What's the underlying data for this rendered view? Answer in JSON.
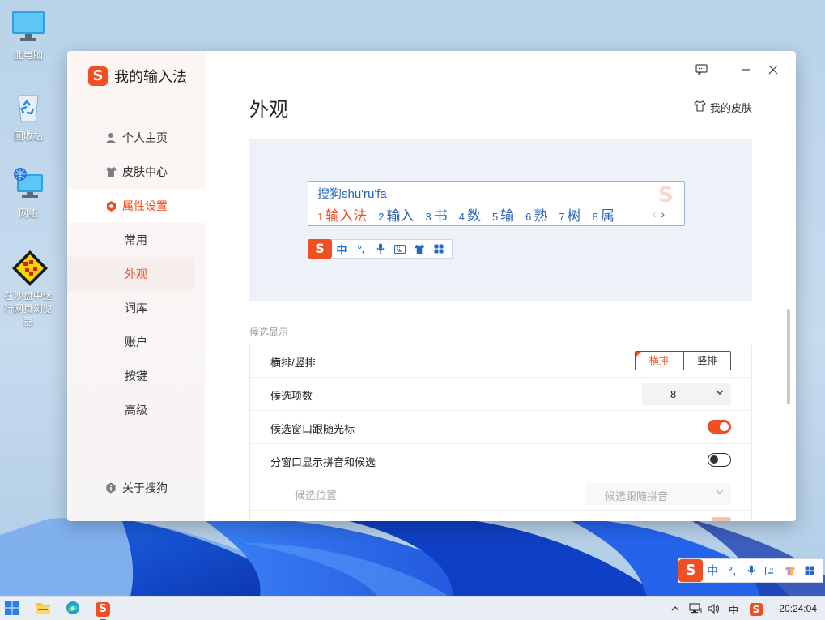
{
  "desktop": {
    "icons": [
      {
        "label": "此电脑"
      },
      {
        "label": "回收站"
      },
      {
        "label": "网络"
      },
      {
        "label": "在沙盘中运行网页浏览器"
      }
    ]
  },
  "window": {
    "app_title": "我的输入法",
    "nav": [
      {
        "label": "个人主页",
        "icon": "user-icon"
      },
      {
        "label": "皮肤中心",
        "icon": "tshirt-icon"
      },
      {
        "label": "属性设置",
        "icon": "settings-hex-icon",
        "active": true
      }
    ],
    "subnav": [
      {
        "label": "常用"
      },
      {
        "label": "外观",
        "active": true
      },
      {
        "label": "词库"
      },
      {
        "label": "账户"
      },
      {
        "label": "按键"
      },
      {
        "label": "高级"
      }
    ],
    "about": "关于搜狗",
    "page_title": "外观",
    "my_skin": "我的皮肤",
    "preview": {
      "pinyin": "搜狗shu'ru'fa",
      "candidates": [
        {
          "num": "1",
          "text": "输入法"
        },
        {
          "num": "2",
          "text": "输入"
        },
        {
          "num": "3",
          "text": "书"
        },
        {
          "num": "4",
          "text": "数"
        },
        {
          "num": "5",
          "text": "输"
        },
        {
          "num": "6",
          "text": "熟"
        },
        {
          "num": "7",
          "text": "树"
        },
        {
          "num": "8",
          "text": "属"
        }
      ],
      "prev_arrow": "‹",
      "next_arrow": "›",
      "logo": "S",
      "status_items": [
        "中",
        "°,",
        "mic",
        "keyboard",
        "skin",
        "toolbox"
      ]
    },
    "section_label": "候选显示",
    "settings": [
      {
        "label": "横排/竖排",
        "type": "segmented",
        "options": [
          "横排",
          "竖排"
        ],
        "selected": "横排"
      },
      {
        "label": "候选项数",
        "type": "select",
        "value": "8"
      },
      {
        "label": "候选窗口跟随光标",
        "type": "toggle",
        "on": true
      },
      {
        "label": "分窗口显示拼音和候选",
        "type": "toggle",
        "on": false
      },
      {
        "label": "候选位置",
        "type": "select",
        "value": "候选跟随拼音",
        "disabled": true
      }
    ]
  },
  "ime_float": {
    "logo": "S",
    "zh": "中",
    "punct": "°,"
  },
  "taskbar": {
    "ime_label": "中",
    "clock": "20:24:04"
  },
  "colors": {
    "accent": "#f04e23",
    "link_blue": "#2a66b8",
    "preview_bg": "#edf1f8"
  }
}
